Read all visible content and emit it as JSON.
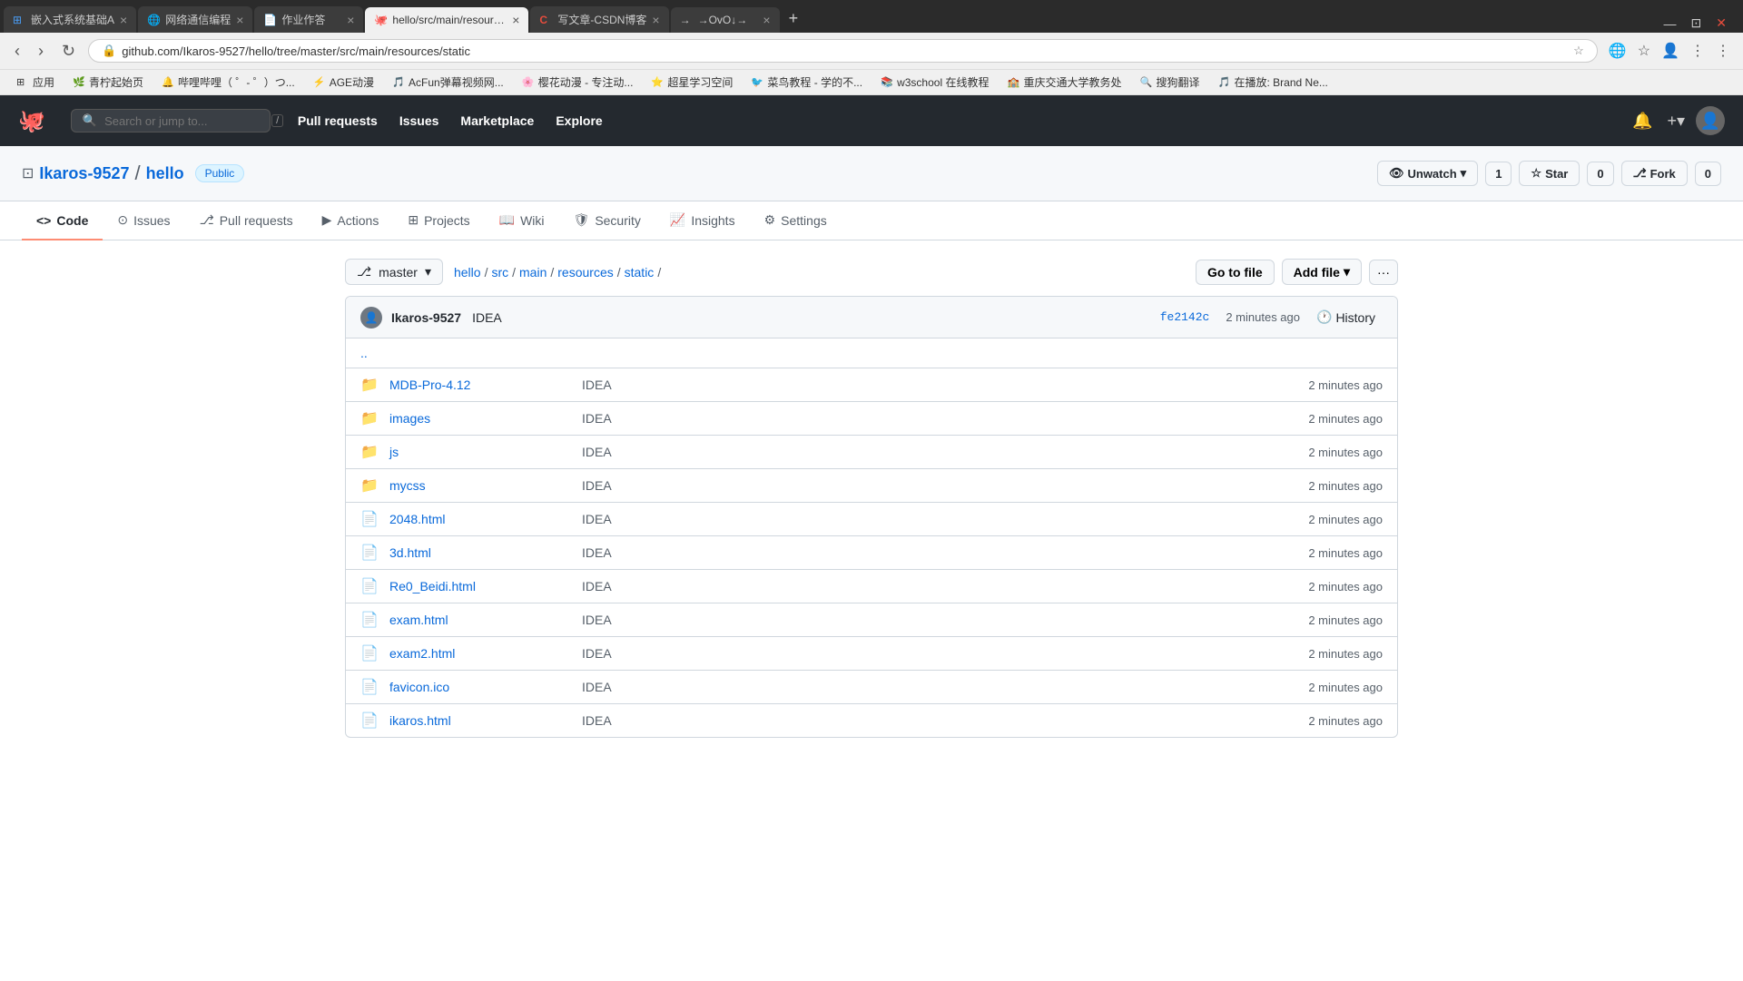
{
  "browser": {
    "tabs": [
      {
        "id": "tab1",
        "favicon": "⊞",
        "favicon_color": "#4a9ef7",
        "title": "嵌入式系统基础A",
        "active": false
      },
      {
        "id": "tab2",
        "favicon": "🌐",
        "favicon_color": "#4a9ef7",
        "title": "网络通信编程",
        "active": false
      },
      {
        "id": "tab3",
        "favicon": "📄",
        "favicon_color": "#888",
        "title": "作业作答",
        "active": false
      },
      {
        "id": "tab4",
        "favicon": "🐙",
        "favicon_color": "#333",
        "title": "hello/src/main/resources/...",
        "active": true
      },
      {
        "id": "tab5",
        "favicon": "C",
        "favicon_color": "#e74c3c",
        "title": "写文章-CSDN博客",
        "active": false
      },
      {
        "id": "tab6",
        "favicon": "→",
        "favicon_color": "#888",
        "title": "→OvO↓→",
        "active": false
      }
    ],
    "address": "github.com/Ikaros-9527/hello/tree/master/src/main/resources/static",
    "bookmarks": [
      {
        "favicon": "⊞",
        "title": "应用"
      },
      {
        "favicon": "🌿",
        "title": "青柠起始页"
      },
      {
        "favicon": "🔔",
        "title": "哔哩哔哩（ ゜- ゜）つ..."
      },
      {
        "favicon": "⚡",
        "title": "AGE动漫"
      },
      {
        "favicon": "🎵",
        "title": "AcFun弹幕视频网..."
      },
      {
        "favicon": "🌸",
        "title": "樱花动漫 - 专注动..."
      },
      {
        "favicon": "⭐",
        "title": "超星学习空间"
      },
      {
        "favicon": "🐦",
        "title": "菜鸟教程 - 学的不..."
      },
      {
        "favicon": "📚",
        "title": "w3school 在线教程"
      },
      {
        "favicon": "🏫",
        "title": "重庆交通大学教务处"
      },
      {
        "favicon": "🔍",
        "title": "搜狗翻译"
      },
      {
        "favicon": "🎵",
        "title": "在播放: Brand Ne..."
      }
    ]
  },
  "github": {
    "header": {
      "search_placeholder": "Search or jump to...",
      "nav_items": [
        "Pull requests",
        "Issues",
        "Marketplace",
        "Explore"
      ]
    },
    "repo": {
      "owner": "Ikaros-9527",
      "name": "hello",
      "visibility": "Public",
      "watch_label": "Unwatch",
      "watch_count": "1",
      "star_label": "Star",
      "star_count": "0",
      "fork_label": "Fork",
      "fork_count": "0"
    },
    "tabs": [
      {
        "id": "code",
        "icon": "<>",
        "label": "Code",
        "active": true
      },
      {
        "id": "issues",
        "icon": "⊙",
        "label": "Issues",
        "active": false
      },
      {
        "id": "pull-requests",
        "icon": "⎇",
        "label": "Pull requests",
        "active": false
      },
      {
        "id": "actions",
        "icon": "▶",
        "label": "Actions",
        "active": false
      },
      {
        "id": "projects",
        "icon": "⊞",
        "label": "Projects",
        "active": false
      },
      {
        "id": "wiki",
        "icon": "📖",
        "label": "Wiki",
        "active": false
      },
      {
        "id": "security",
        "icon": "🛡",
        "label": "Security",
        "active": false
      },
      {
        "id": "insights",
        "icon": "📈",
        "label": "Insights",
        "active": false
      },
      {
        "id": "settings",
        "icon": "⚙",
        "label": "Settings",
        "active": false
      }
    ],
    "file_browser": {
      "branch": "master",
      "path_parts": [
        "hello",
        "src",
        "main",
        "resources",
        "static"
      ],
      "commit": {
        "author": "Ikaros-9527",
        "message": "IDEA",
        "hash": "fe2142c",
        "time": "2 minutes ago",
        "history_label": "History"
      },
      "actions": {
        "go_to_file": "Go to file",
        "add_file": "Add file",
        "more": "···"
      },
      "files": [
        {
          "type": "dir",
          "name": "MDB-Pro-4.12",
          "commit_msg": "IDEA",
          "time": "2 minutes ago"
        },
        {
          "type": "dir",
          "name": "images",
          "commit_msg": "IDEA",
          "time": "2 minutes ago"
        },
        {
          "type": "dir",
          "name": "js",
          "commit_msg": "IDEA",
          "time": "2 minutes ago"
        },
        {
          "type": "dir",
          "name": "mycss",
          "commit_msg": "IDEA",
          "time": "2 minutes ago"
        },
        {
          "type": "file",
          "name": "2048.html",
          "commit_msg": "IDEA",
          "time": "2 minutes ago"
        },
        {
          "type": "file",
          "name": "3d.html",
          "commit_msg": "IDEA",
          "time": "2 minutes ago"
        },
        {
          "type": "file",
          "name": "Re0_Beidi.html",
          "commit_msg": "IDEA",
          "time": "2 minutes ago"
        },
        {
          "type": "file",
          "name": "exam.html",
          "commit_msg": "IDEA",
          "time": "2 minutes ago"
        },
        {
          "type": "file",
          "name": "exam2.html",
          "commit_msg": "IDEA",
          "time": "2 minutes ago"
        },
        {
          "type": "file",
          "name": "favicon.ico",
          "commit_msg": "IDEA",
          "time": "2 minutes ago"
        },
        {
          "type": "file",
          "name": "ikaros.html",
          "commit_msg": "IDEA",
          "time": "2 minutes ago"
        }
      ]
    }
  }
}
